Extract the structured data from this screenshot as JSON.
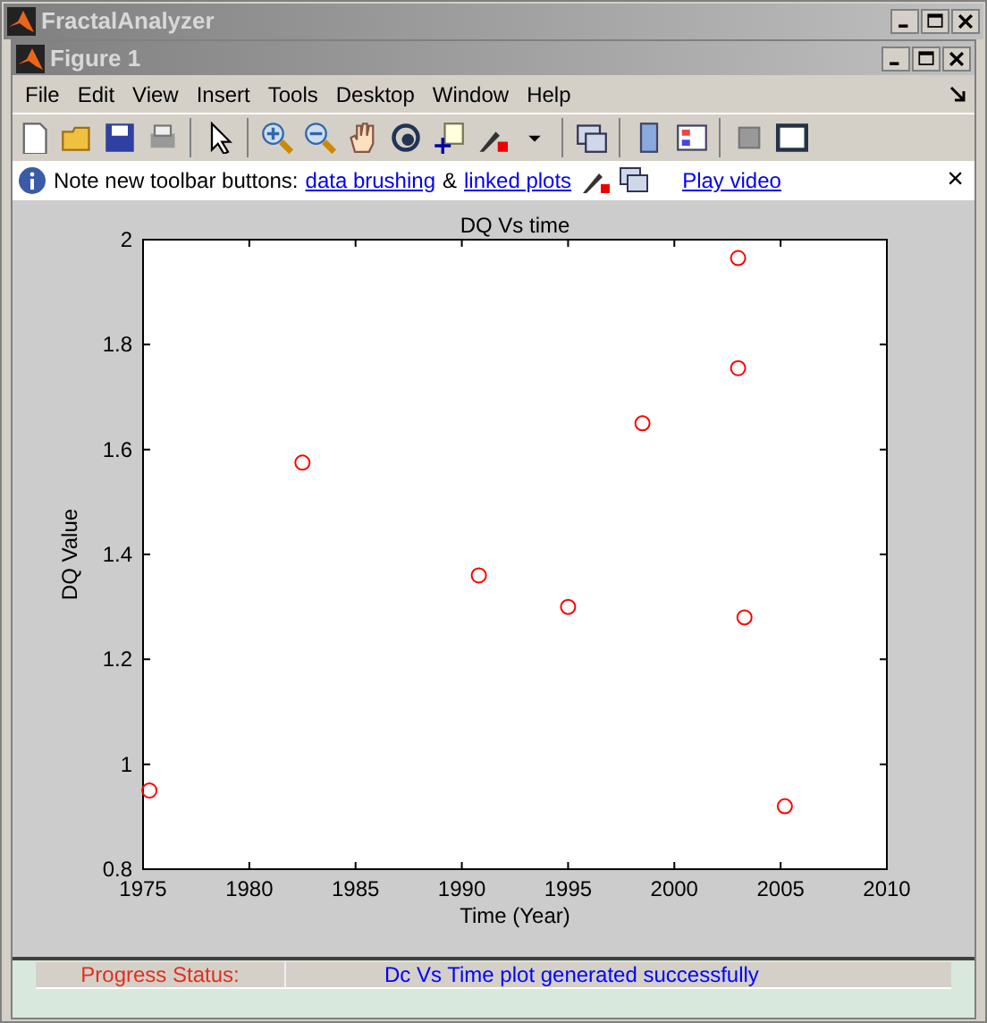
{
  "app_window": {
    "title": "FractalAnalyzer"
  },
  "figure_window": {
    "title": "Figure 1"
  },
  "menu": [
    "File",
    "Edit",
    "View",
    "Insert",
    "Tools",
    "Desktop",
    "Window",
    "Help"
  ],
  "info_bar": {
    "text": "Note new toolbar buttons:",
    "link_1": "data brushing",
    "separator": "&",
    "link_2": "linked plots",
    "video_link": "Play video",
    "close": "×"
  },
  "plot": {
    "chart_data": {
      "type": "scatter",
      "title": "DQ Vs time",
      "xlabel": "Time (Year)",
      "ylabel": "DQ Value",
      "x": [
        1975.3,
        1982.5,
        1990.8,
        1995,
        1998.5,
        2003,
        2003,
        2003.3,
        2005.2
      ],
      "series": [
        {
          "color": "#ff0000",
          "values": [
            0.95,
            1.575,
            1.36,
            1.3,
            1.65,
            1.965,
            1.755,
            1.28,
            0.92
          ]
        }
      ],
      "xlim": [
        1975,
        2010
      ],
      "ylim": [
        0.8,
        2
      ],
      "xticks": [
        1975,
        1980,
        1985,
        1990,
        1995,
        2000,
        2005,
        2010
      ],
      "yticks": [
        0.8,
        1,
        1.2,
        1.4,
        1.6,
        1.8,
        2
      ]
    }
  },
  "status": {
    "label": "Progress Status:",
    "message": "Dc Vs Time plot generated successfully"
  }
}
